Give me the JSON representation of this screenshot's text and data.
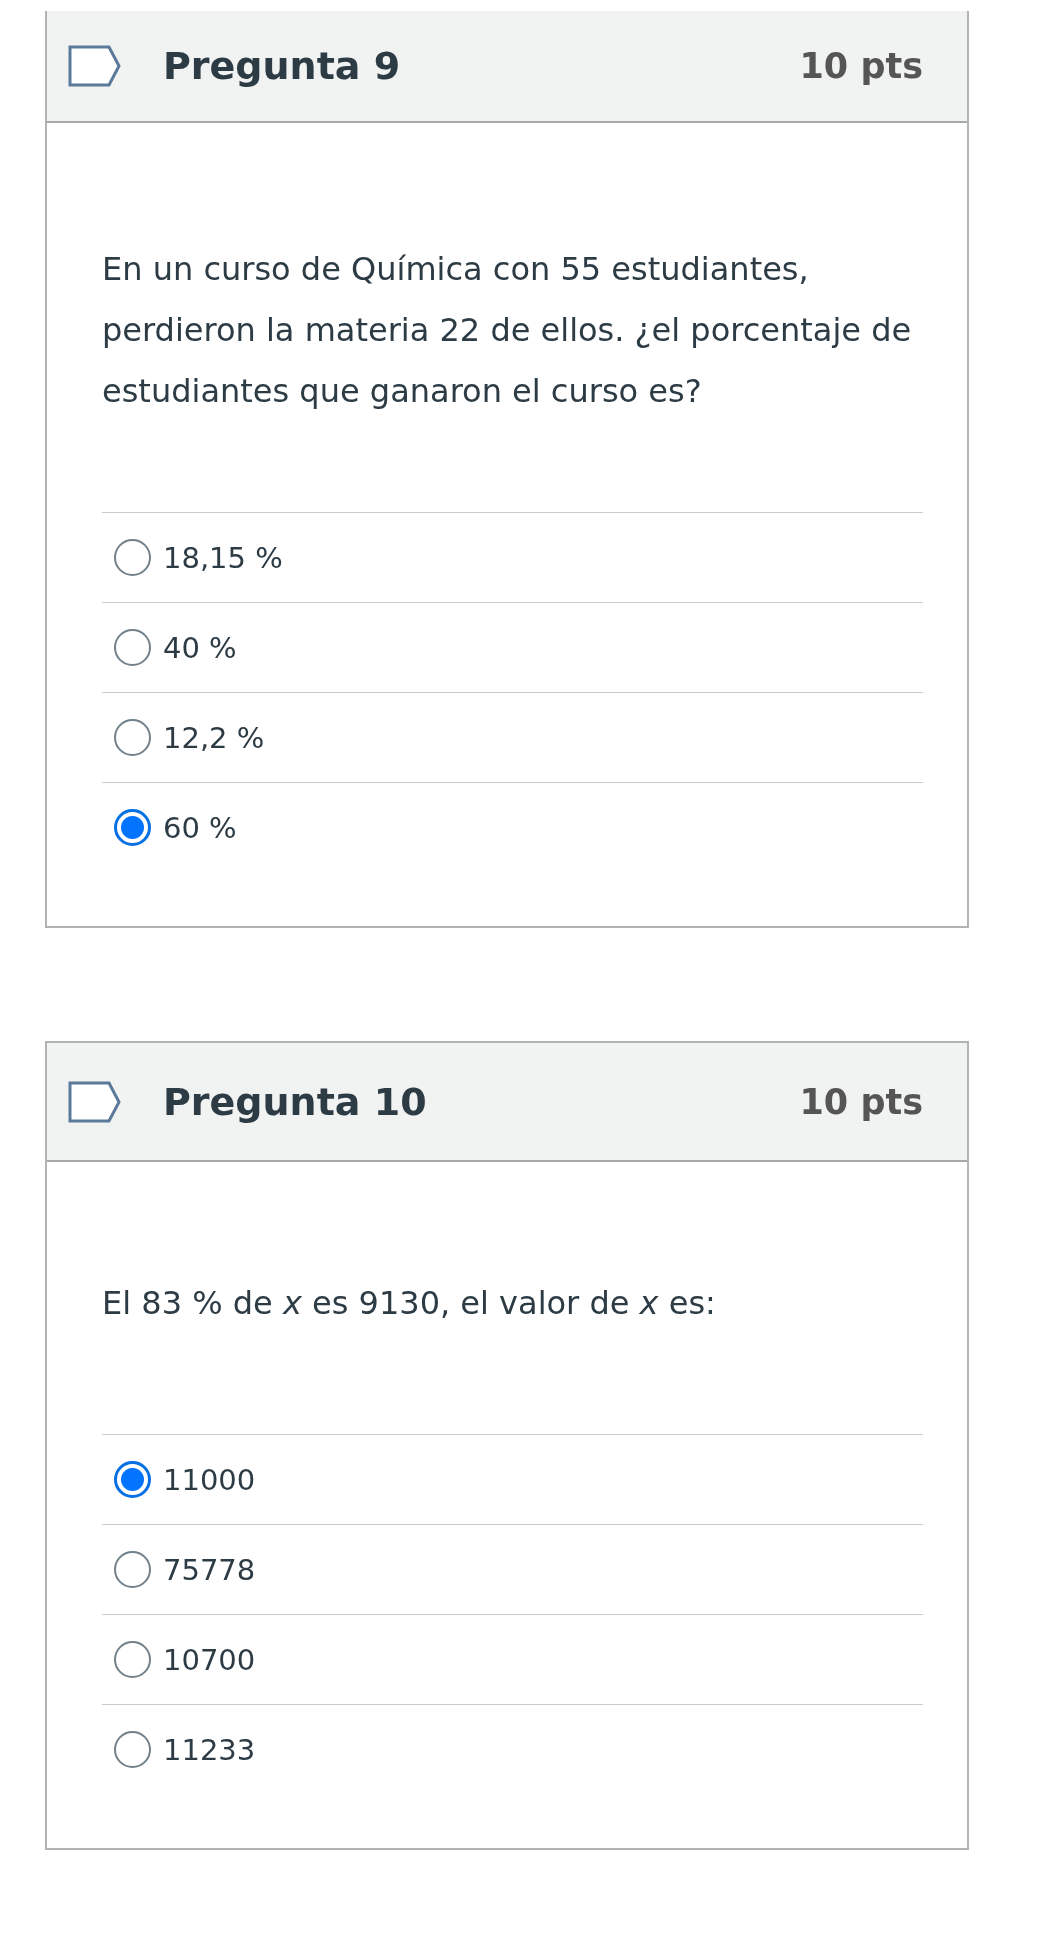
{
  "questions": [
    {
      "title": "Pregunta 9",
      "points": "10 pts",
      "text": "En un curso de Química con 55 estudiantes, perdieron la materia 22 de ellos. ¿el porcentaje de estudiantes que ganaron el curso es?",
      "options": [
        {
          "label": "18,15 %",
          "selected": false
        },
        {
          "label": "40 %",
          "selected": false
        },
        {
          "label": "12,2 %",
          "selected": false
        },
        {
          "label": "60 %",
          "selected": true
        }
      ]
    },
    {
      "title": "Pregunta 10",
      "points": "10 pts",
      "text": "El 83 % de *x* es 9130, el valor de *x* es:",
      "options": [
        {
          "label": "11000",
          "selected": true
        },
        {
          "label": "75778",
          "selected": false
        },
        {
          "label": "10700",
          "selected": false
        },
        {
          "label": "11233",
          "selected": false
        }
      ]
    }
  ]
}
